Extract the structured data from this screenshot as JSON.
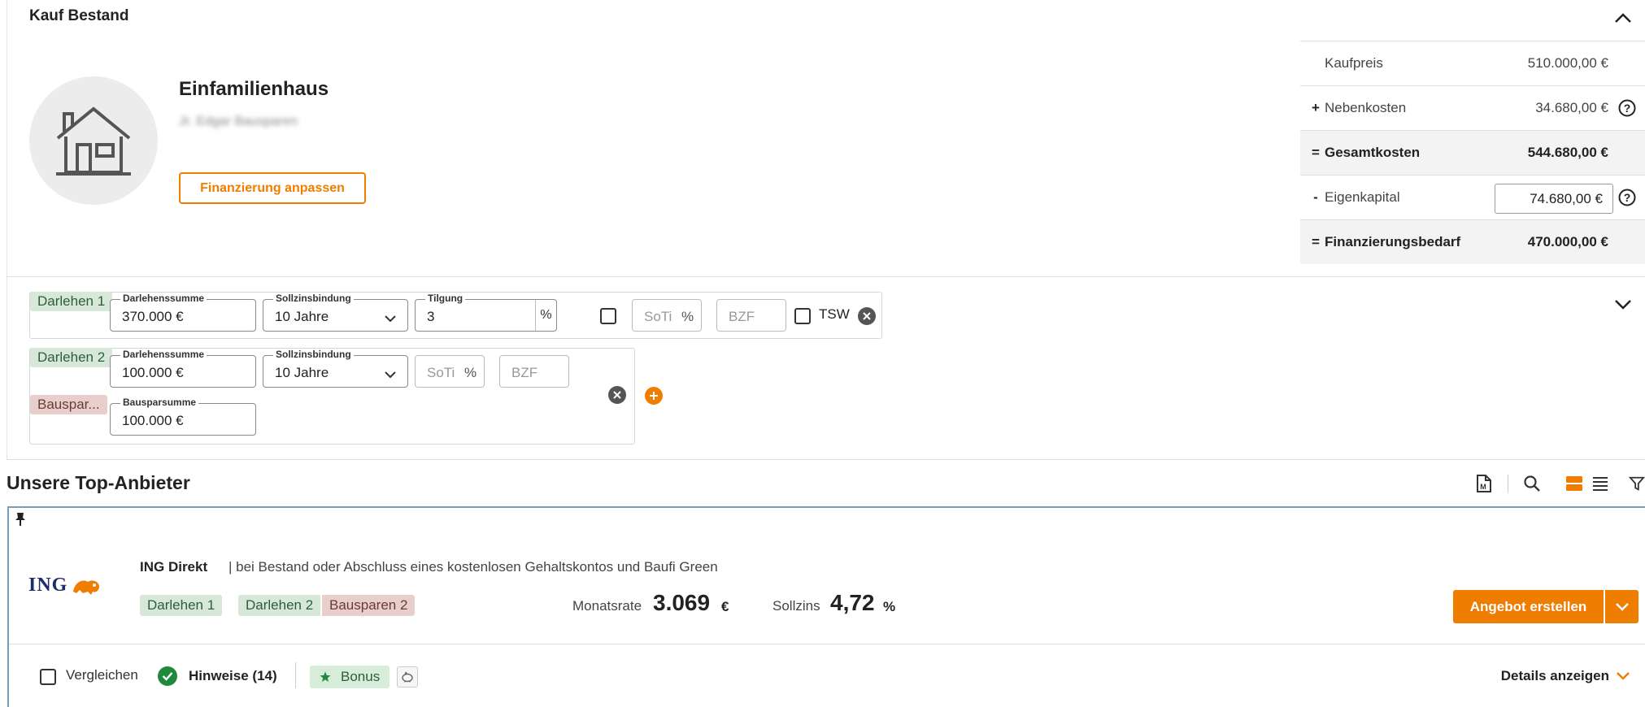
{
  "section": {
    "title": "Kauf Bestand"
  },
  "object": {
    "title": "Einfamilienhaus",
    "subtitle": "Jr. Edgar Bausparen",
    "adjust_button": "Finanzierung anpassen"
  },
  "costs": {
    "rows": [
      {
        "sign": "",
        "label": "Kaufpreis",
        "value": "510.000,00 €"
      },
      {
        "sign": "+",
        "label": "Nebenkosten",
        "value": "34.680,00 €"
      },
      {
        "sign": "=",
        "label": "Gesamtkosten",
        "value": "544.680,00 €"
      },
      {
        "sign": "-",
        "label": "Eigenkapital",
        "value": "74.680,00 €"
      },
      {
        "sign": "=",
        "label": "Finanzierungsbedarf",
        "value": "470.000,00 €"
      }
    ]
  },
  "loans": {
    "loan1": {
      "tag": "Darlehen 1",
      "amount_label": "Darlehenssumme",
      "amount": "370.000 €",
      "fixed_label": "Sollzinsbindung",
      "fixed": "10 Jahre",
      "tilgung_label": "Tilgung",
      "tilgung": "3",
      "tilgung_unit": "%",
      "soti": "SoTi",
      "soti_unit": "%",
      "bzf": "BZF",
      "tsw": "TSW"
    },
    "loan2": {
      "tag": "Darlehen 2",
      "amount_label": "Darlehenssumme",
      "amount": "100.000 €",
      "fixed_label": "Sollzinsbindung",
      "fixed": "10 Jahre",
      "soti": "SoTi",
      "soti_unit": "%",
      "bzf": "BZF",
      "bauspar_tag": "Bauspar...",
      "bauspar_label": "Bausparsumme",
      "bauspar": "100.000 €"
    }
  },
  "providers": {
    "title": "Unsere Top-Anbieter",
    "card": {
      "logo_text": "ING",
      "name": "ING Direkt",
      "description": "| bei Bestand oder Abschluss eines kostenlosen Gehaltskontos und Baufi Green",
      "tags": [
        "Darlehen 1",
        "Darlehen 2",
        "Bausparen 2"
      ],
      "monthly_label": "Monatsrate",
      "monthly_value": "3.069",
      "monthly_unit": "€",
      "rate_label": "Sollzins",
      "rate_value": "4,72",
      "rate_unit": "%",
      "offer_button": "Angebot erstellen",
      "compare_label": "Vergleichen",
      "hints_label": "Hinweise (14)",
      "bonus_label": "Bonus",
      "details_label": "Details anzeigen"
    }
  },
  "colors": {
    "accent": "#ef7d00",
    "green_tag": "#d7e8d9",
    "red_tag": "#e8cfcc",
    "card_border": "#6fa2b8"
  }
}
